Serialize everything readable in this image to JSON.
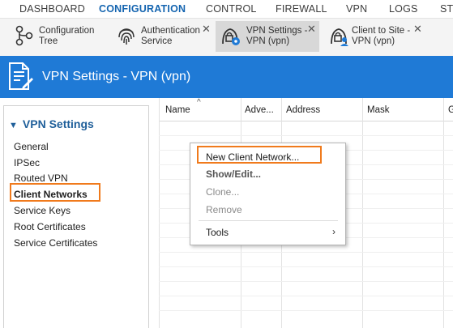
{
  "topnav": {
    "items": [
      "DASHBOARD",
      "CONFIGURATION",
      "CONTROL",
      "FIREWALL",
      "VPN",
      "LOGS",
      "ST"
    ]
  },
  "tabs": [
    {
      "label": "Configuration\nTree",
      "icon": "tree-icon",
      "closable": false
    },
    {
      "label": "Authentication\nService",
      "icon": "fingerprint-icon",
      "closable": true
    },
    {
      "label": "VPN Settings -\nVPN (vpn)",
      "icon": "vpn-settings-icon",
      "closable": true
    },
    {
      "label": "Client to Site -\nVPN (vpn)",
      "icon": "client-to-site-icon",
      "closable": true
    }
  ],
  "header": {
    "title": "VPN Settings - VPN (vpn)",
    "icon": "document-edit-icon"
  },
  "sidebar": {
    "heading": "VPN Settings",
    "items": [
      "General",
      "IPSec",
      "Routed VPN",
      "Client Networks",
      "Service Keys",
      "Root Certificates",
      "Service Certificates"
    ],
    "selected": "Client Networks"
  },
  "grid": {
    "columns": [
      "Name",
      "Adve...",
      "Address",
      "Mask",
      "G"
    ]
  },
  "context_menu": {
    "items": [
      {
        "label": "New Client Network...",
        "state": "highlighted"
      },
      {
        "label": "Show/Edit...",
        "state": "bold"
      },
      {
        "label": "Clone...",
        "state": "disabled"
      },
      {
        "label": "Remove",
        "state": "disabled"
      },
      {
        "label": "Tools",
        "state": "submenu"
      }
    ]
  },
  "colors": {
    "accent": "#1f7ad6",
    "highlight": "#f07a1c",
    "active_nav": "#1565b0"
  }
}
